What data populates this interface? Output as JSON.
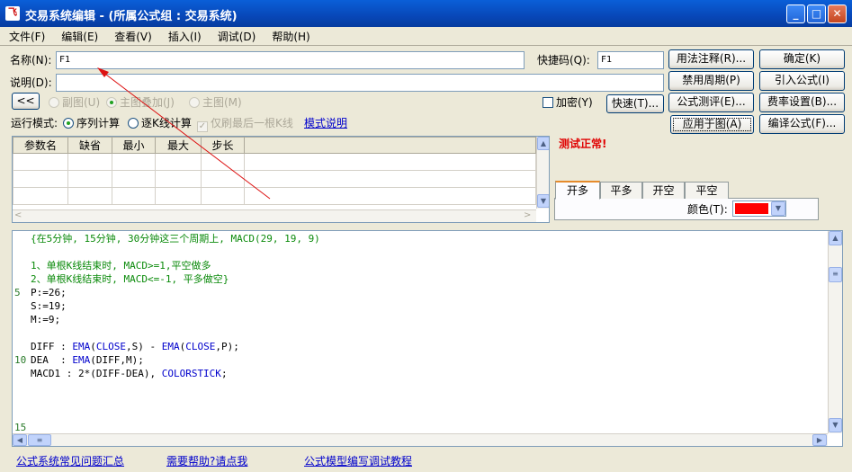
{
  "window": {
    "title": "交易系统编辑 - (所属公式组 : 交易系统)",
    "icon_text": "飞"
  },
  "menu": [
    "文件(F)",
    "编辑(E)",
    "查看(V)",
    "插入(I)",
    "调试(D)",
    "帮助(H)"
  ],
  "form": {
    "name_label": "名称(N):",
    "name_value": "F1",
    "shortcut_label": "快捷码(Q):",
    "shortcut_value": "F1",
    "desc_label": "说明(D):",
    "desc_value": "",
    "collapse_label": "<<",
    "radio_sub": "副图(U)",
    "radio_overlay": "主图叠加(J)",
    "radio_main": "主图(M)",
    "encrypt_label": "加密(Y)",
    "fast_label": "快速(T)...",
    "run_mode_label": "运行模式:",
    "mode_seq": "序列计算",
    "mode_bar": "逐K线计算",
    "mode_refresh": "仅刷最后一根K线",
    "mode_help": "模式说明"
  },
  "buttons": {
    "usage": "用法注释(R)...",
    "ok": "确定(K)",
    "disable_period": "禁用周期(P)",
    "import": "引入公式(I)",
    "test": "公式测评(E)...",
    "fee": "费率设置(B)...",
    "apply": "应用于图(A)",
    "compile": "编译公式(F)..."
  },
  "params": {
    "headers": [
      "参数名",
      "缺省",
      "最小",
      "最大",
      "步长"
    ],
    "row_count": 4
  },
  "status": {
    "text": "测试正常!",
    "color": "#e00000"
  },
  "signal_tabs": [
    "开多",
    "平多",
    "开空",
    "平空"
  ],
  "color_label": "颜色(T):",
  "signal_color": "#ff0000",
  "code": {
    "lines": [
      {
        "num": "",
        "text": "{在5分钟, 15分钟, 30分钟这三个周期上, MACD(29, 19, 9)",
        "cls": "cmt"
      },
      {
        "num": "",
        "text": "",
        "cls": ""
      },
      {
        "num": "",
        "text": "1、单根K线结束时, MACD>=1,平空做多",
        "cls": "cmt"
      },
      {
        "num": "",
        "text": "2、单根K线结束时, MACD<=-1, 平多做空}",
        "cls": "cmt"
      },
      {
        "num": "5",
        "text": "P:=26;",
        "cls": ""
      },
      {
        "num": "",
        "text": "S:=19;",
        "cls": ""
      },
      {
        "num": "",
        "text": "M:=9;",
        "cls": ""
      },
      {
        "num": "",
        "text": "",
        "cls": ""
      },
      {
        "num": "",
        "text": "DIFF : EMA(CLOSE,S) - EMA(CLOSE,P);",
        "cls": "mix1"
      },
      {
        "num": "10",
        "text": "DEA  : EMA(DIFF,M);",
        "cls": "mix2"
      },
      {
        "num": "",
        "text": "MACD1 : 2*(DIFF-DEA), COLORSTICK;",
        "cls": "mix3"
      },
      {
        "num": "",
        "text": "",
        "cls": ""
      },
      {
        "num": "",
        "text": "",
        "cls": ""
      },
      {
        "num": "",
        "text": "",
        "cls": ""
      },
      {
        "num": "15",
        "text": "",
        "cls": ""
      }
    ]
  },
  "footer_links": [
    "公式系统常见问题汇总",
    "需要帮助?请点我",
    "公式模型编写调试教程"
  ]
}
